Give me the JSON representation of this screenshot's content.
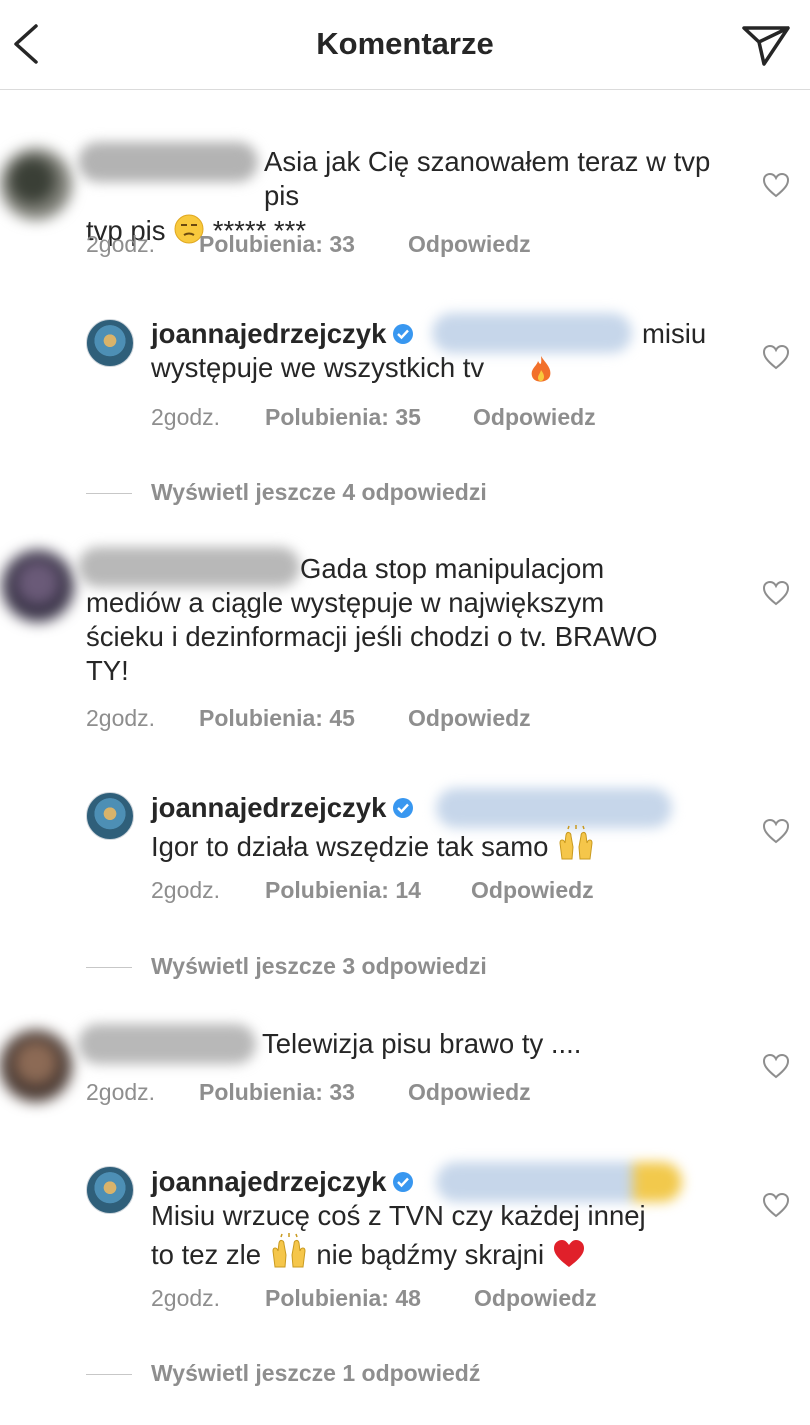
{
  "header": {
    "title": "Komentarze"
  },
  "threads": [
    {
      "comment": {
        "text": "Asia jak Cię szanowałem teraz w tvp pis",
        "text_tail": "***** ***",
        "time": "2godz.",
        "likes": "Polubienia: 33",
        "reply": "Odpowiedz"
      },
      "reply": {
        "username": "joannajedrzejczyk",
        "text_line1": "misiu",
        "text_line2": "występuje we wszystkich tv",
        "time": "2godz.",
        "likes": "Polubienia: 35",
        "reply": "Odpowiedz"
      },
      "view_more": "Wyświetl jeszcze 4 odpowiedzi"
    },
    {
      "comment": {
        "text_line1": "Gada stop manipulacjom",
        "text_line2": "mediów a ciągle występuje w największym",
        "text_line3": "ścieku i dezinformacji jeśli chodzi o tv. BRAWO",
        "text_line4": "TY!",
        "time": "2godz.",
        "likes": "Polubienia: 45",
        "reply": "Odpowiedz"
      },
      "reply": {
        "username": "joannajedrzejczyk",
        "text": "Igor to działa wszędzie tak samo",
        "time": "2godz.",
        "likes": "Polubienia: 14",
        "reply": "Odpowiedz"
      },
      "view_more": "Wyświetl jeszcze 3 odpowiedzi"
    },
    {
      "comment": {
        "text": "Telewizja pisu brawo ty ....",
        "time": "2godz.",
        "likes": "Polubienia: 33",
        "reply": "Odpowiedz"
      },
      "reply": {
        "username": "joannajedrzejczyk",
        "text_line1": "Misiu wrzucę coś z TVN czy każdej innej",
        "text_line2a": "to tez zle",
        "text_line2b": "nie bądźmy skrajni",
        "time": "2godz.",
        "likes": "Polubienia: 48",
        "reply": "Odpowiedz"
      },
      "view_more": "Wyświetl jeszcze 1 odpowiedź"
    }
  ],
  "icons": {
    "back": "chevron-left-icon",
    "send": "paper-plane-icon",
    "like": "heart-outline-icon",
    "verified": "verified-badge-icon"
  },
  "colors": {
    "verified": "#3897f0",
    "meta": "#8e8e8e",
    "text": "#262626"
  }
}
